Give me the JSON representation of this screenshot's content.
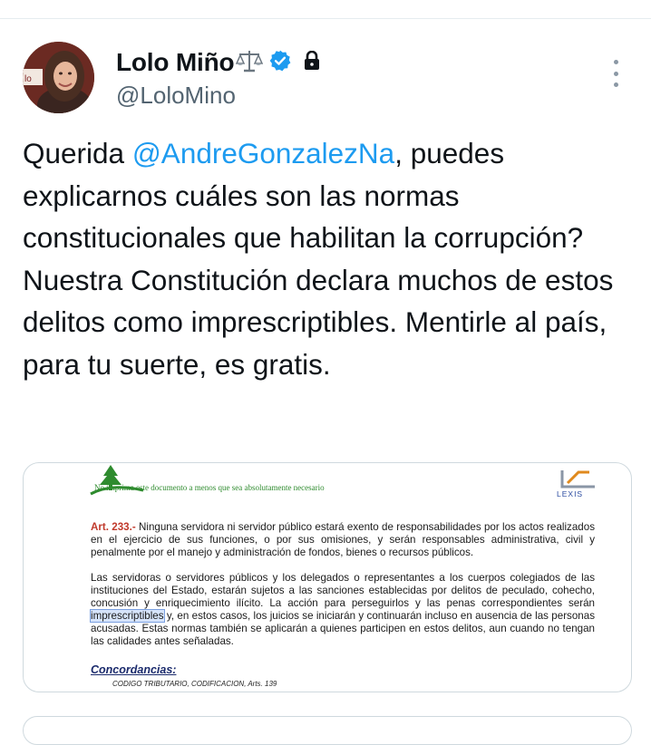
{
  "tweet": {
    "author_name": "Lolo Miño",
    "author_handle": "@LoloMino",
    "text_prefix": "Querida ",
    "mention": "@AndreGonzalezNa",
    "text_suffix": ", puedes explicarnos cuáles son las normas constitucionales que habilitan la corrupción? Nuestra Constitución declara muchos de estos delitos como imprescriptibles. Mentirle al país, para tu suerte, es gratis.",
    "icons": [
      "scales-emoji-icon",
      "verified-badge-icon",
      "lock-icon",
      "more-options-icon"
    ],
    "colors": {
      "mention": "#1d9bf0",
      "verified": "#1d9bf0",
      "text": "#0f1419",
      "handle": "#536471"
    }
  },
  "document": {
    "banner": "No imprima este documento a menos que sea absolutamente necesario",
    "logo": "LEXIS",
    "article_label": "Art. 233.-",
    "para1": " Ninguna servidora ni servidor público estará exento de responsabilidades por los actos realizados en el ejercicio de sus funciones, o por sus omisiones, y serán responsables administrativa, civil y penalmente por el manejo y administración de fondos, bienes o recursos públicos.",
    "para2_before": "Las servidoras o servidores públicos y los delegados o representantes a los cuerpos colegiados de las instituciones del Estado, estarán sujetos a las sanciones establecidas por delitos de peculado, cohecho, concusión y enriquecimiento ilícito. La acción para perseguirlos y las penas correspondientes serán ",
    "para2_highlight": "imprescriptibles",
    "para2_after": " y, en estos casos, los juicios se iniciarán y continuarán incluso en ausencia de las personas acusadas. Estas normas también se aplicarán a quienes participen en estos delitos, aun cuando no tengan las calidades antes señaladas.",
    "concordancias_label": "Concordancias:",
    "reference": "CODIGO TRIBUTARIO, CODIFICACION, Arts. 139"
  }
}
